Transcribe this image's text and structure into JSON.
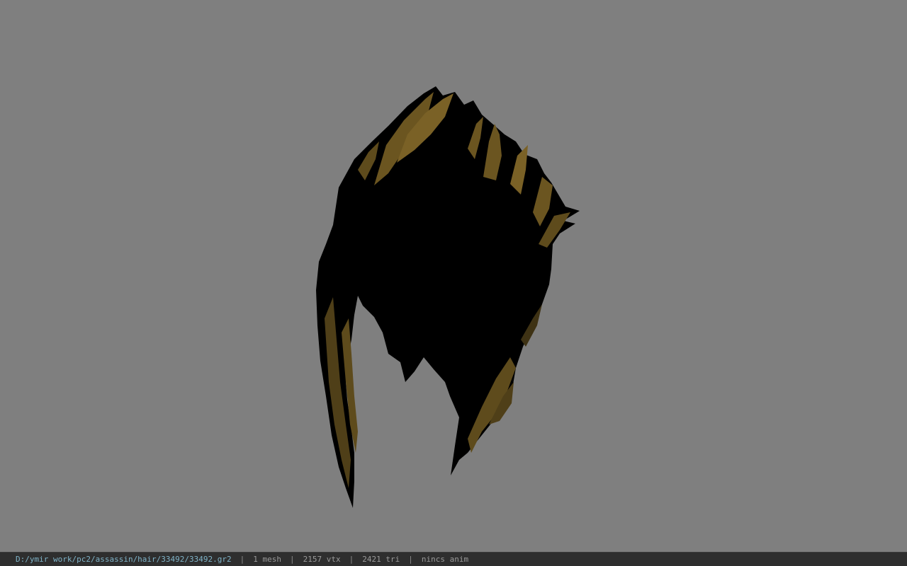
{
  "viewer": {
    "background_color": "#7f7f7f",
    "model_name": "33492.gr2",
    "model_colors": {
      "base": "#000000",
      "highlight": "#6b5520",
      "highlight_light": "#8a6d2a"
    }
  },
  "statusbar": {
    "path": "D:/ymir work/pc2/assassin/hair/33492/33492.gr2",
    "separator": "|",
    "mesh": "1 mesh",
    "vertices": "2157 vtx",
    "triangles": "2421 tri",
    "anim": "nincs anim"
  }
}
